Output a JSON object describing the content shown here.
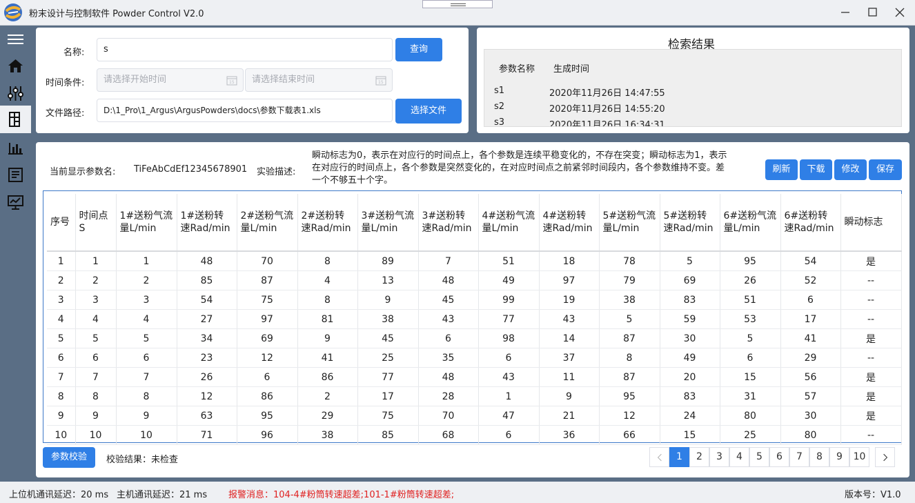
{
  "window": {
    "title": "粉末设计与控制软件 Powder Control V2.0"
  },
  "query": {
    "name_label": "名称:",
    "name_value": "s",
    "query_button": "查询",
    "time_label": "时间条件:",
    "start_placeholder": "请选择开始时间",
    "end_placeholder": "请选择结束时间",
    "path_label": "文件路径:",
    "path_value": "D:\\1_Pro\\1_Argus\\ArgusPowders\\docs\\参数下载表1.xls",
    "file_button": "选择文件"
  },
  "results": {
    "title": "检索结果",
    "col_name": "参数名称",
    "col_time": "生成时间",
    "rows": [
      {
        "name": "s1",
        "time": "2020年11月26日 14:47:55"
      },
      {
        "name": "s2",
        "time": "2020年11月26日 14:55:20"
      },
      {
        "name": "s3",
        "time": "2020年11月26日 16:34:31"
      }
    ]
  },
  "detail": {
    "current_label": "当前显示参数名:",
    "current_value": "TiFeAbCdEf12345678901",
    "desc_label": "实验描述:",
    "desc_line1": "瞬动标志为0，表示在对应行的时间点上，各个参数是连续平稳变化的，不存在突变；瞬动标志为1，表示",
    "desc_line2": "在对应行的时间点上，各个参数是突然变化的，在对应时间点之前紧邻时间段内，各个参数维持不变。差",
    "desc_line3": "一个不够五十个字。",
    "refresh": "刷新",
    "download": "下载",
    "modify": "修改",
    "save": "保存"
  },
  "table": {
    "headers": [
      "序号",
      "时间点S",
      "1#送粉气流量L/min",
      "1#送粉转速Rad/min",
      "2#送粉气流量L/min",
      "2#送粉转速Rad/min",
      "3#送粉气流量L/min",
      "3#送粉转速Rad/min",
      "4#送粉气流量L/min",
      "4#送粉转速Rad/min",
      "5#送粉气流量L/min",
      "5#送粉转速Rad/min",
      "6#送粉气流量L/min",
      "6#送粉转速Rad/min",
      "瞬动标志"
    ],
    "rows": [
      [
        "1",
        "1",
        "1",
        "48",
        "70",
        "8",
        "89",
        "7",
        "51",
        "18",
        "78",
        "5",
        "95",
        "54",
        "是"
      ],
      [
        "2",
        "2",
        "2",
        "85",
        "87",
        "4",
        "13",
        "48",
        "49",
        "97",
        "79",
        "69",
        "26",
        "52",
        "--"
      ],
      [
        "3",
        "3",
        "3",
        "54",
        "75",
        "8",
        "9",
        "45",
        "99",
        "19",
        "38",
        "83",
        "51",
        "6",
        "--"
      ],
      [
        "4",
        "4",
        "4",
        "27",
        "97",
        "81",
        "38",
        "43",
        "77",
        "43",
        "5",
        "59",
        "53",
        "17",
        "--"
      ],
      [
        "5",
        "5",
        "5",
        "34",
        "69",
        "9",
        "45",
        "6",
        "98",
        "14",
        "87",
        "30",
        "5",
        "41",
        "是"
      ],
      [
        "6",
        "6",
        "6",
        "23",
        "12",
        "41",
        "25",
        "35",
        "6",
        "37",
        "8",
        "49",
        "6",
        "29",
        "--"
      ],
      [
        "7",
        "7",
        "7",
        "26",
        "6",
        "86",
        "77",
        "48",
        "43",
        "11",
        "87",
        "20",
        "15",
        "56",
        "是"
      ],
      [
        "8",
        "8",
        "8",
        "12",
        "86",
        "2",
        "17",
        "28",
        "1",
        "9",
        "95",
        "83",
        "31",
        "57",
        "是"
      ],
      [
        "9",
        "9",
        "9",
        "63",
        "95",
        "29",
        "75",
        "70",
        "47",
        "21",
        "12",
        "24",
        "80",
        "30",
        "是"
      ],
      [
        "10",
        "10",
        "10",
        "71",
        "96",
        "38",
        "85",
        "68",
        "6",
        "36",
        "66",
        "15",
        "25",
        "80",
        "--"
      ]
    ]
  },
  "footer": {
    "check_button": "参数校验",
    "check_result": "校验结果：未检查",
    "pages": [
      "1",
      "2",
      "3",
      "4",
      "5",
      "6",
      "7",
      "8",
      "9",
      "10"
    ],
    "current_page": "1"
  },
  "status": {
    "upper_delay": "上位机通讯延迟：20 ms",
    "host_delay": "主机通讯延迟：21 ms",
    "alarm": "报警消息：104-4#粉筒转速超差;101-1#粉筒转速超差;",
    "version": "版本号：V1.0"
  },
  "colors": {
    "accent": "#2f7fe6",
    "sidebar": "#5a6e85",
    "alarm": "#e02020"
  }
}
